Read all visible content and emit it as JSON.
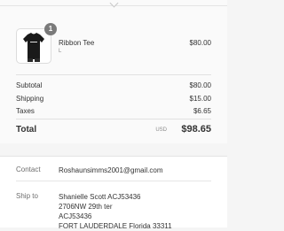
{
  "order_summary": {
    "items": [
      {
        "name": "Ribbon Tee",
        "variant": "L",
        "price": "$80.00",
        "quantity": "1",
        "image_icon": "black-tshirt-icon"
      }
    ],
    "subtotal_label": "Subtotal",
    "subtotal_value": "$80.00",
    "shipping_label": "Shipping",
    "shipping_value": "$15.00",
    "taxes_label": "Taxes",
    "taxes_value": "$6.65",
    "total_label": "Total",
    "total_currency": "USD",
    "total_value": "$98.65"
  },
  "info": {
    "contact_label": "Contact",
    "contact_value": "Roshaunsimms2001@gmail.com",
    "ship_to_label": "Ship to",
    "ship_to_lines": [
      "Shanielle Scott ACJ53436",
      "2706NW 29th ter",
      "ACJ53436",
      "FORT LAUDERDALE Florida 33311"
    ]
  }
}
